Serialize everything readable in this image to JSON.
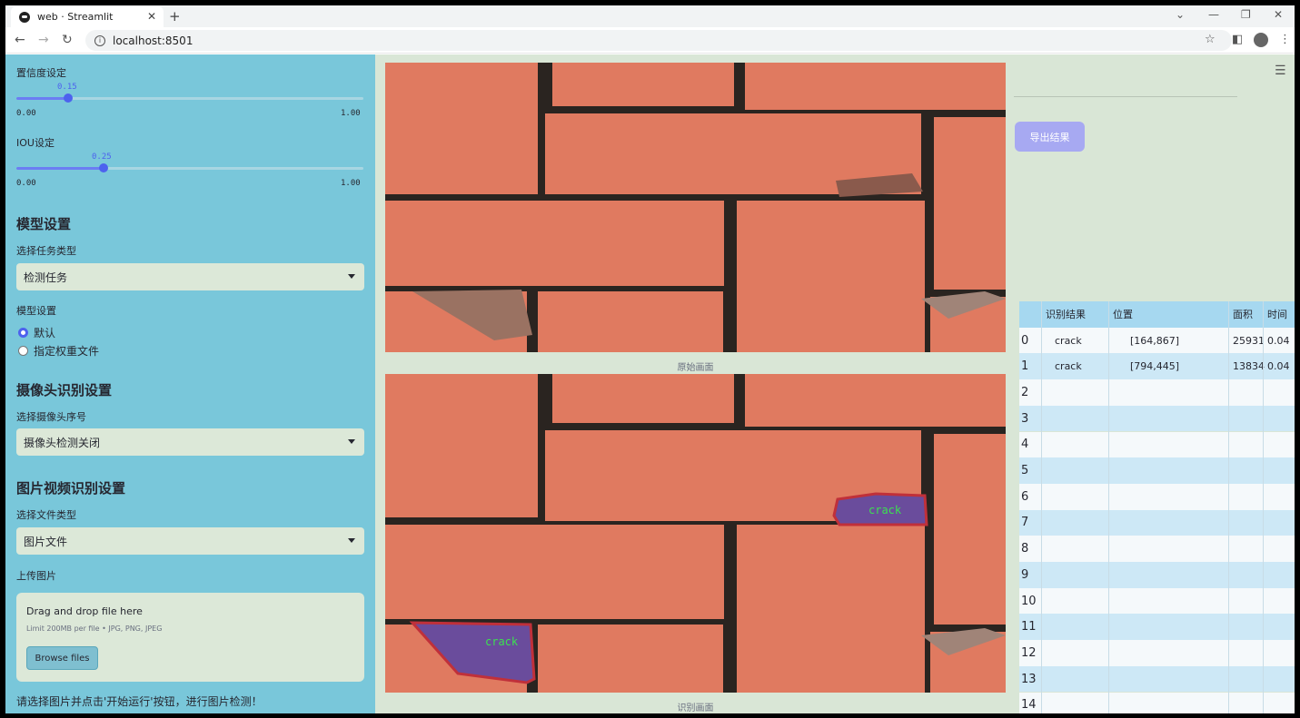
{
  "browser": {
    "tab_title": "web · Streamlit",
    "tab_close": "✕",
    "new_tab": "+",
    "url": "localhost:8501",
    "win_min": "—",
    "win_max": "❐",
    "win_close": "✕",
    "win_chevron": "⌄"
  },
  "sidebar": {
    "confidence_label": "置信度设定",
    "confidence_value": "0.15",
    "confidence_fraction": 0.15,
    "iou_label": "IOU设定",
    "iou_value": "0.25",
    "iou_fraction": 0.25,
    "range_min": "0.00",
    "range_max": "1.00",
    "model_header": "模型设置",
    "task_label": "选择任务类型",
    "task_value": "检测任务",
    "model_label": "模型设置",
    "radio_default": "默认",
    "radio_custom": "指定权重文件",
    "camera_header": "摄像头识别设置",
    "camera_label": "选择摄像头序号",
    "camera_value": "摄像头检测关闭",
    "media_header": "图片视频识别设置",
    "filetype_label": "选择文件类型",
    "filetype_value": "图片文件",
    "upload_label": "上传图片",
    "drag_text": "Drag and drop file here",
    "limit_text": "Limit 200MB per file • JPG, PNG, JPEG",
    "browse_label": "Browse files",
    "note": "请选择图片并点击'开始运行'按钮，进行图片检测！"
  },
  "main": {
    "caption_original": "原始画面",
    "caption_detected": "识别画面",
    "detection_label": "crack"
  },
  "right": {
    "export_label": "导出结果",
    "table": {
      "headers": [
        "识别结果",
        "位置",
        "面积",
        "时间"
      ],
      "rows": [
        {
          "index": "0",
          "result": "crack",
          "position": "[164,867]",
          "area": "25931",
          "time": "0.04"
        },
        {
          "index": "1",
          "result": "crack",
          "position": "[794,445]",
          "area": "13834",
          "time": "0.04"
        },
        {
          "index": "2",
          "result": "",
          "position": "",
          "area": "",
          "time": ""
        },
        {
          "index": "3",
          "result": "",
          "position": "",
          "area": "",
          "time": ""
        },
        {
          "index": "4",
          "result": "",
          "position": "",
          "area": "",
          "time": ""
        },
        {
          "index": "5",
          "result": "",
          "position": "",
          "area": "",
          "time": ""
        },
        {
          "index": "6",
          "result": "",
          "position": "",
          "area": "",
          "time": ""
        },
        {
          "index": "7",
          "result": "",
          "position": "",
          "area": "",
          "time": ""
        },
        {
          "index": "8",
          "result": "",
          "position": "",
          "area": "",
          "time": ""
        },
        {
          "index": "9",
          "result": "",
          "position": "",
          "area": "",
          "time": ""
        },
        {
          "index": "10",
          "result": "",
          "position": "",
          "area": "",
          "time": ""
        },
        {
          "index": "11",
          "result": "",
          "position": "",
          "area": "",
          "time": ""
        },
        {
          "index": "12",
          "result": "",
          "position": "",
          "area": "",
          "time": ""
        },
        {
          "index": "13",
          "result": "",
          "position": "",
          "area": "",
          "time": ""
        },
        {
          "index": "14",
          "result": "",
          "position": "",
          "area": "",
          "time": ""
        }
      ]
    }
  },
  "colors": {
    "sidebar_bg": "#79c7da",
    "main_bg": "#d9e6d6",
    "accent": "#4d62ee",
    "brick": "#e07a60",
    "mortar": "#2a2420",
    "mask": "#6a4c9c",
    "mask_outline": "#c0303a",
    "label_green": "#3ce050"
  }
}
